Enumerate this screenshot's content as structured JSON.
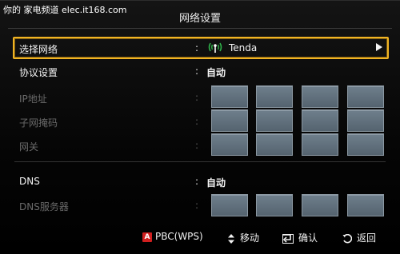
{
  "watermark": {
    "text": "你的 家电频道 elec.it168.com"
  },
  "header": {
    "title": "网络设置"
  },
  "settings": [
    {
      "label": "选择网络",
      "colon": ":",
      "value": "Tenda",
      "icon": "wifi-signal-icon",
      "selected": true,
      "disabled": false
    },
    {
      "label": "协议设置",
      "colon": ":",
      "value": "自动",
      "selected": false,
      "disabled": false
    },
    {
      "label": "IP地址",
      "colon": ":",
      "disabled": true
    },
    {
      "label": "子网掩码",
      "colon": ":",
      "disabled": true
    },
    {
      "label": "网关",
      "colon": ":",
      "disabled": true
    },
    {
      "label": "DNS",
      "colon": ":",
      "value": "自动",
      "selected": false,
      "disabled": false
    },
    {
      "label": "DNS服务器",
      "colon": ":",
      "disabled": true
    }
  ],
  "footer": {
    "pbc_badge": "A",
    "pbc_label": "PBC(WPS)",
    "move_label": "移动",
    "enter_label": "确认",
    "return_label": "返回"
  },
  "colors": {
    "selection_border": "#f0b323",
    "field_box": "#64727e",
    "pbc_badge": "#d11f1f"
  }
}
